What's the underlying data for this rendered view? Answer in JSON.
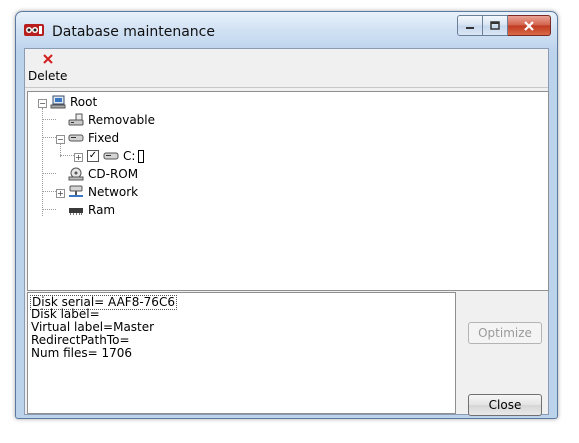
{
  "window": {
    "title": "Database maintenance"
  },
  "toolbar": {
    "delete_label": "Delete",
    "delete_icon": "delete-x-icon",
    "accent": "#d21f1f"
  },
  "tree": {
    "root": "Root",
    "removable": "Removable",
    "fixed": "Fixed",
    "c_drive": "C:",
    "cdrom": "CD-ROM",
    "network": "Network",
    "ram": "Ram"
  },
  "info": {
    "lines": [
      "Disk serial= AAF8-76C6",
      "Disk label=",
      "Virtual label=Master",
      "RedirectPathTo=",
      "Num files= 1706"
    ]
  },
  "buttons": {
    "optimize": "Optimize",
    "close": "Close"
  }
}
